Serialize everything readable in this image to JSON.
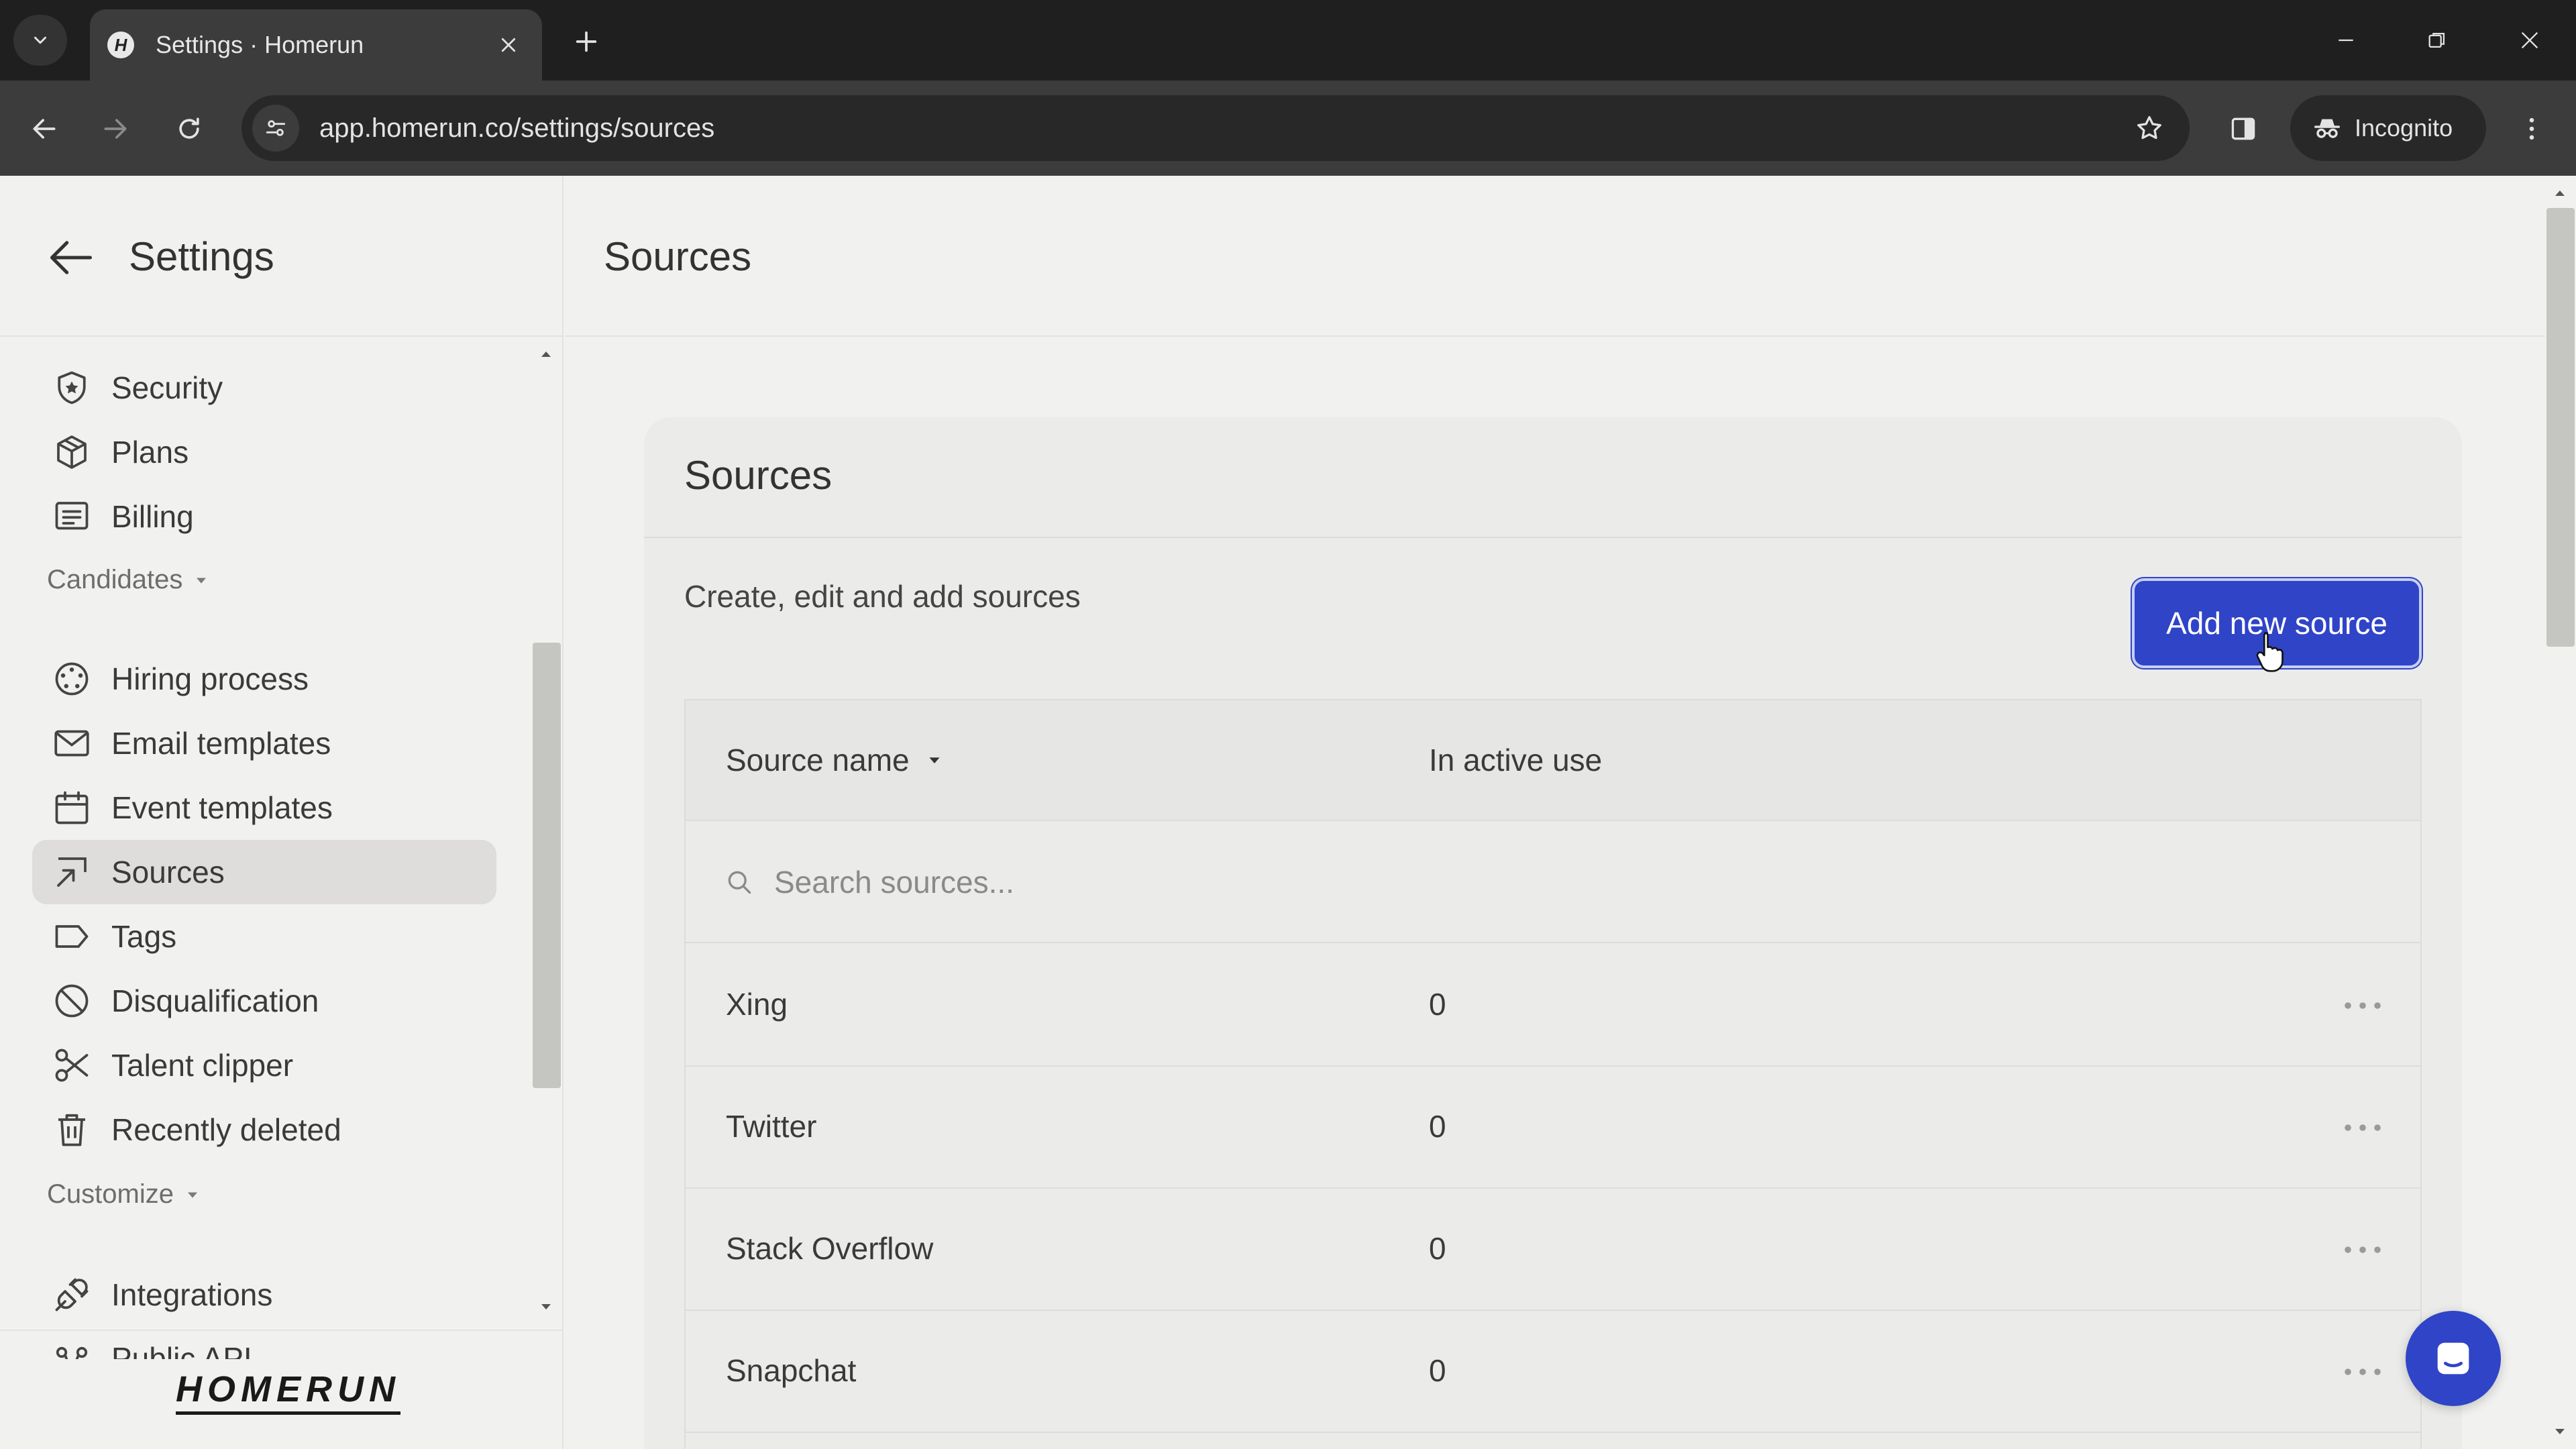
{
  "browser": {
    "tab_title": "Settings · Homerun",
    "favicon_letter": "H",
    "url": "app.homerun.co/settings/sources",
    "profile_label": "Incognito"
  },
  "sidebar": {
    "title": "Settings",
    "items_top": [
      {
        "label": "Security",
        "icon": "shield-icon"
      },
      {
        "label": "Plans",
        "icon": "box-icon"
      },
      {
        "label": "Billing",
        "icon": "receipt-icon"
      }
    ],
    "candidates_header": "Candidates",
    "candidates_items": [
      {
        "label": "Hiring process",
        "icon": "process-icon"
      },
      {
        "label": "Email templates",
        "icon": "mail-icon"
      },
      {
        "label": "Event templates",
        "icon": "calendar-icon"
      },
      {
        "label": "Sources",
        "icon": "sources-icon",
        "active": true
      },
      {
        "label": "Tags",
        "icon": "tag-icon"
      },
      {
        "label": "Disqualification",
        "icon": "block-icon"
      },
      {
        "label": "Talent clipper",
        "icon": "scissors-icon"
      },
      {
        "label": "Recently deleted",
        "icon": "trash-icon"
      }
    ],
    "customize_header": "Customize",
    "customize_items": [
      {
        "label": "Integrations",
        "icon": "plug-icon"
      },
      {
        "label": "Public API",
        "icon": "api-icon"
      }
    ],
    "logo": "HOMERUN"
  },
  "main": {
    "header_title": "Sources",
    "card": {
      "title": "Sources",
      "description": "Create, edit and add sources",
      "add_button": "Add new source",
      "table": {
        "col_name": "Source name",
        "col_use": "In active use",
        "search_placeholder": "Search sources...",
        "rows": [
          {
            "name": "Xing",
            "count": "0"
          },
          {
            "name": "Twitter",
            "count": "0"
          },
          {
            "name": "Stack Overflow",
            "count": "0"
          },
          {
            "name": "Snapchat",
            "count": "0"
          }
        ]
      }
    }
  },
  "colors": {
    "accent": "#2f44c7",
    "background": "#f1f1ef",
    "card": "#ebebe9",
    "chrome_dark": "#1f1f1f"
  }
}
